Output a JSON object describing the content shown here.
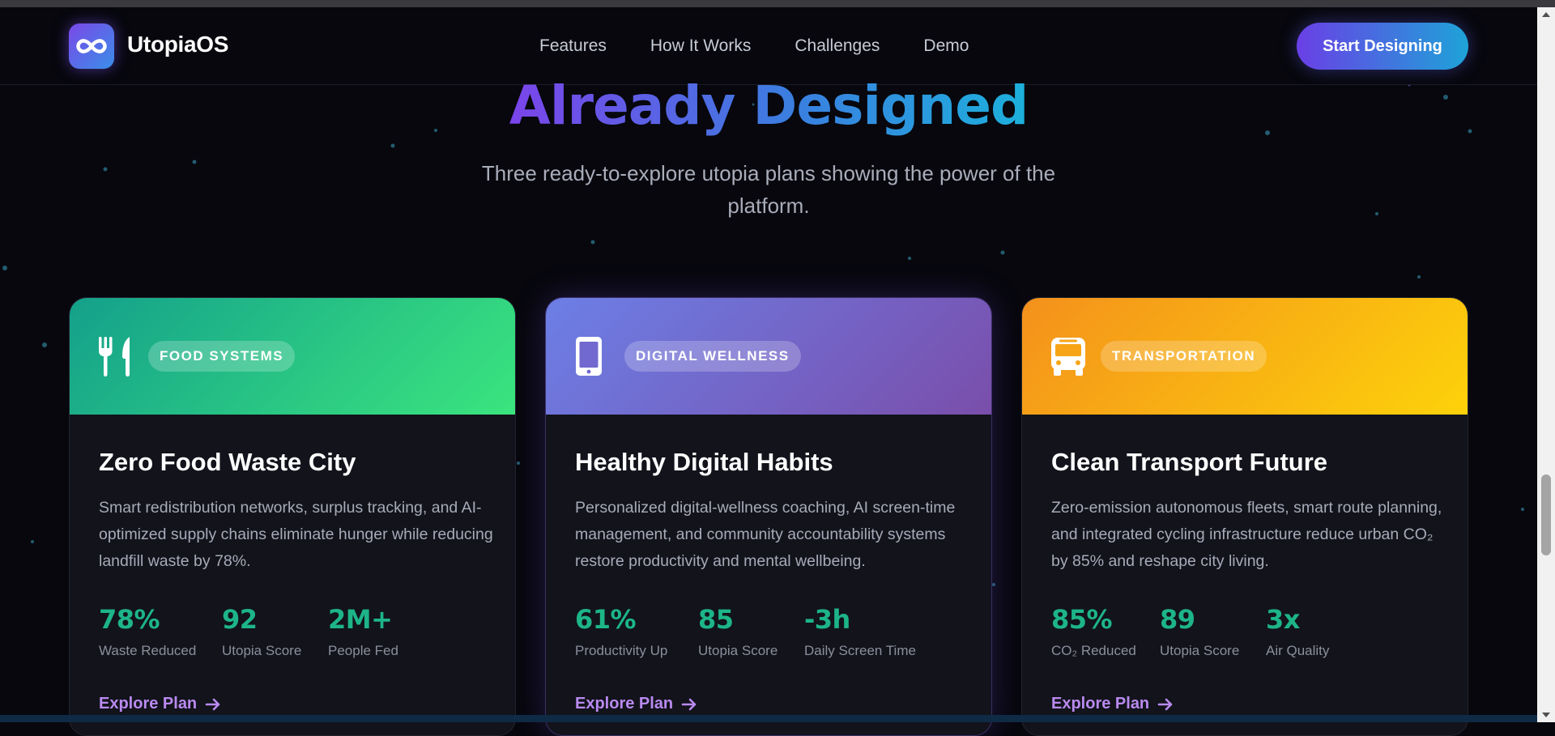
{
  "nav": {
    "brand": "UtopiaOS",
    "links": [
      "Features",
      "How It Works",
      "Challenges",
      "Demo"
    ],
    "cta_label": "Start Designing"
  },
  "section": {
    "heading": "Already Designed",
    "subtitle": "Three ready-to-explore utopia plans showing the power of the platform."
  },
  "cards": [
    {
      "icon": "fork-knife-icon",
      "badge": "FOOD SYSTEMS",
      "title": "Zero Food Waste City",
      "description": "Smart redistribution networks, surplus tracking, and AI-optimized supply chains eliminate hunger while reducing landfill waste by 78%.",
      "stats": [
        {
          "value": "78%",
          "label": "Waste Reduced"
        },
        {
          "value": "92",
          "label": "Utopia Score"
        },
        {
          "value": "2M+",
          "label": "People Fed"
        }
      ],
      "cta": "Explore Plan"
    },
    {
      "icon": "smartphone-icon",
      "badge": "DIGITAL WELLNESS",
      "title": "Healthy Digital Habits",
      "description": "Personalized digital-wellness coaching, AI screen-time management, and community accountability systems restore productivity and mental wellbeing.",
      "stats": [
        {
          "value": "61%",
          "label": "Productivity Up"
        },
        {
          "value": "85",
          "label": "Utopia Score"
        },
        {
          "value": "-3h",
          "label": "Daily Screen Time"
        }
      ],
      "cta": "Explore Plan"
    },
    {
      "icon": "bus-icon",
      "badge": "TRANSPORTATION",
      "title": "Clean Transport Future",
      "description": "Zero-emission autonomous fleets, smart route planning, and integrated cycling infrastructure reduce urban CO₂ by 85% and reshape city living.",
      "stats": [
        {
          "value": "85%",
          "label": "CO₂ Reduced"
        },
        {
          "value": "89",
          "label": "Utopia Score"
        },
        {
          "value": "3x",
          "label": "Air Quality"
        }
      ],
      "cta": "Explore Plan"
    }
  ],
  "colors": {
    "background": "#07070d",
    "accent_purple": "#7b44ea",
    "accent_cyan": "#1db0dc",
    "stat_green": "#1db587",
    "link_purple": "#b98af0"
  }
}
